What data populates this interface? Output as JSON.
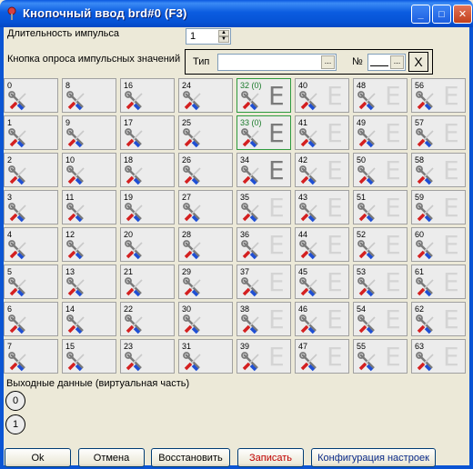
{
  "window": {
    "title": "Кнопочный ввод brd#0 (F3)",
    "controls": {
      "minimize": "_",
      "maximize": "□",
      "close": "✕"
    }
  },
  "pulse": {
    "label": "Длительность импульса",
    "value": "1"
  },
  "poll_button": {
    "label": "Кнопка опроса импульсных значений",
    "type_label": "Тип",
    "type_browse": "...",
    "number_label": "№",
    "number_browse": "...",
    "clear": "X"
  },
  "cells": [
    {
      "label": "0",
      "e": "none"
    },
    {
      "label": "8",
      "e": "none"
    },
    {
      "label": "16",
      "e": "none"
    },
    {
      "label": "24",
      "e": "none"
    },
    {
      "label": "32 (0)",
      "e": "dark",
      "active": true
    },
    {
      "label": "40",
      "e": "light"
    },
    {
      "label": "48",
      "e": "light"
    },
    {
      "label": "56",
      "e": "light"
    },
    {
      "label": "1",
      "e": "none"
    },
    {
      "label": "9",
      "e": "none"
    },
    {
      "label": "17",
      "e": "none"
    },
    {
      "label": "25",
      "e": "none"
    },
    {
      "label": "33 (0)",
      "e": "dark",
      "active": true
    },
    {
      "label": "41",
      "e": "light"
    },
    {
      "label": "49",
      "e": "light"
    },
    {
      "label": "57",
      "e": "light"
    },
    {
      "label": "2",
      "e": "none"
    },
    {
      "label": "10",
      "e": "none"
    },
    {
      "label": "18",
      "e": "none"
    },
    {
      "label": "26",
      "e": "none"
    },
    {
      "label": "34",
      "e": "dark"
    },
    {
      "label": "42",
      "e": "light"
    },
    {
      "label": "50",
      "e": "light"
    },
    {
      "label": "58",
      "e": "light"
    },
    {
      "label": "3",
      "e": "none"
    },
    {
      "label": "11",
      "e": "none"
    },
    {
      "label": "19",
      "e": "none"
    },
    {
      "label": "27",
      "e": "none"
    },
    {
      "label": "35",
      "e": "light"
    },
    {
      "label": "43",
      "e": "light"
    },
    {
      "label": "51",
      "e": "light"
    },
    {
      "label": "59",
      "e": "light"
    },
    {
      "label": "4",
      "e": "none"
    },
    {
      "label": "12",
      "e": "none"
    },
    {
      "label": "20",
      "e": "none"
    },
    {
      "label": "28",
      "e": "none"
    },
    {
      "label": "36",
      "e": "light"
    },
    {
      "label": "44",
      "e": "light"
    },
    {
      "label": "52",
      "e": "light"
    },
    {
      "label": "60",
      "e": "light"
    },
    {
      "label": "5",
      "e": "none"
    },
    {
      "label": "13",
      "e": "none"
    },
    {
      "label": "21",
      "e": "none"
    },
    {
      "label": "29",
      "e": "none"
    },
    {
      "label": "37",
      "e": "light"
    },
    {
      "label": "45",
      "e": "light"
    },
    {
      "label": "53",
      "e": "light"
    },
    {
      "label": "61",
      "e": "light"
    },
    {
      "label": "6",
      "e": "none"
    },
    {
      "label": "14",
      "e": "none"
    },
    {
      "label": "22",
      "e": "none"
    },
    {
      "label": "30",
      "e": "none"
    },
    {
      "label": "38",
      "e": "light"
    },
    {
      "label": "46",
      "e": "light"
    },
    {
      "label": "54",
      "e": "light"
    },
    {
      "label": "62",
      "e": "light"
    },
    {
      "label": "7",
      "e": "none"
    },
    {
      "label": "15",
      "e": "none"
    },
    {
      "label": "23",
      "e": "none"
    },
    {
      "label": "31",
      "e": "none"
    },
    {
      "label": "39",
      "e": "light"
    },
    {
      "label": "47",
      "e": "light"
    },
    {
      "label": "55",
      "e": "light"
    },
    {
      "label": "63",
      "e": "light"
    }
  ],
  "cell_e_letter": "E",
  "output": {
    "label": "Выходные данные (виртуальная часть)",
    "items": [
      "0",
      "1"
    ]
  },
  "buttons": {
    "ok": "Ok",
    "cancel": "Отмена",
    "restore": "Восстановить",
    "save": "Записать",
    "config": "Конфигурация настроек"
  },
  "colors": {
    "title_bar": "#0b5ce0",
    "active_cell_border": "#2e9a3e",
    "save_text": "#c00000",
    "config_text": "#0a2a8a"
  },
  "icons": {
    "window_icon": "pushpin-icon",
    "cell_icon": "screwdriver-wrench-icon"
  }
}
